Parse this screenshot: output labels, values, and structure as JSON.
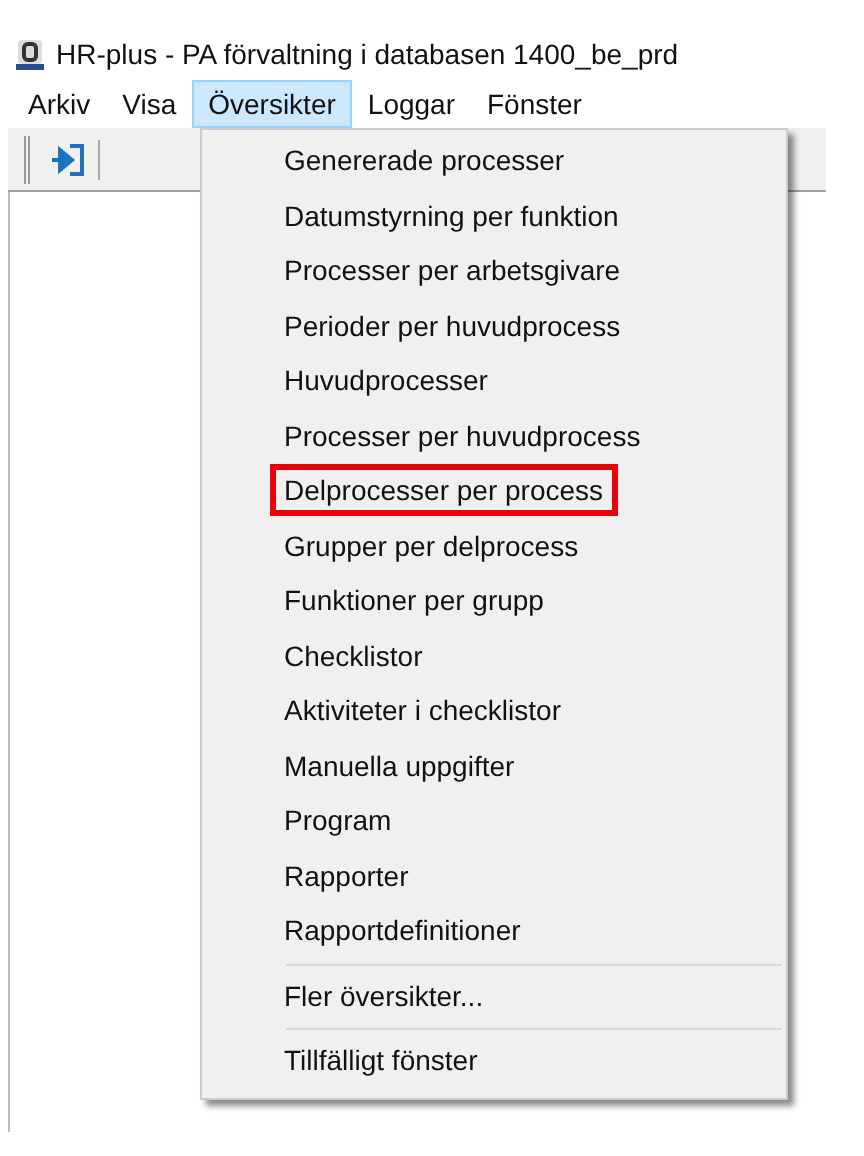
{
  "window": {
    "title": "HR-plus - PA förvaltning i databasen 1400_be_prd"
  },
  "menu_bar": [
    {
      "label": "Arkiv",
      "selected": false
    },
    {
      "label": "Visa",
      "selected": false
    },
    {
      "label": "Översikter",
      "selected": true
    },
    {
      "label": "Loggar",
      "selected": false
    },
    {
      "label": "Fönster",
      "selected": false
    }
  ],
  "dropdown": [
    {
      "kind": "item",
      "label": "Genererade processer",
      "highlighted": false
    },
    {
      "kind": "item",
      "label": "Datumstyrning per funktion",
      "highlighted": false
    },
    {
      "kind": "item",
      "label": "Processer per arbetsgivare",
      "highlighted": false
    },
    {
      "kind": "item",
      "label": "Perioder per huvudprocess",
      "highlighted": false
    },
    {
      "kind": "item",
      "label": "Huvudprocesser",
      "highlighted": false
    },
    {
      "kind": "item",
      "label": "Processer per huvudprocess",
      "highlighted": false
    },
    {
      "kind": "item",
      "label": "Delprocesser per process",
      "highlighted": true
    },
    {
      "kind": "item",
      "label": "Grupper per delprocess",
      "highlighted": false
    },
    {
      "kind": "item",
      "label": "Funktioner per grupp",
      "highlighted": false
    },
    {
      "kind": "item",
      "label": "Checklistor",
      "highlighted": false
    },
    {
      "kind": "item",
      "label": "Aktiviteter i checklistor",
      "highlighted": false
    },
    {
      "kind": "item",
      "label": "Manuella uppgifter",
      "highlighted": false
    },
    {
      "kind": "item",
      "label": "Program",
      "highlighted": false
    },
    {
      "kind": "item",
      "label": "Rapporter",
      "highlighted": false
    },
    {
      "kind": "item",
      "label": "Rapportdefinitioner",
      "highlighted": false
    },
    {
      "kind": "separator"
    },
    {
      "kind": "item",
      "label": "Fler översikter...",
      "highlighted": false
    },
    {
      "kind": "separator"
    },
    {
      "kind": "item",
      "label": "Tillfälligt fönster",
      "highlighted": false
    }
  ]
}
